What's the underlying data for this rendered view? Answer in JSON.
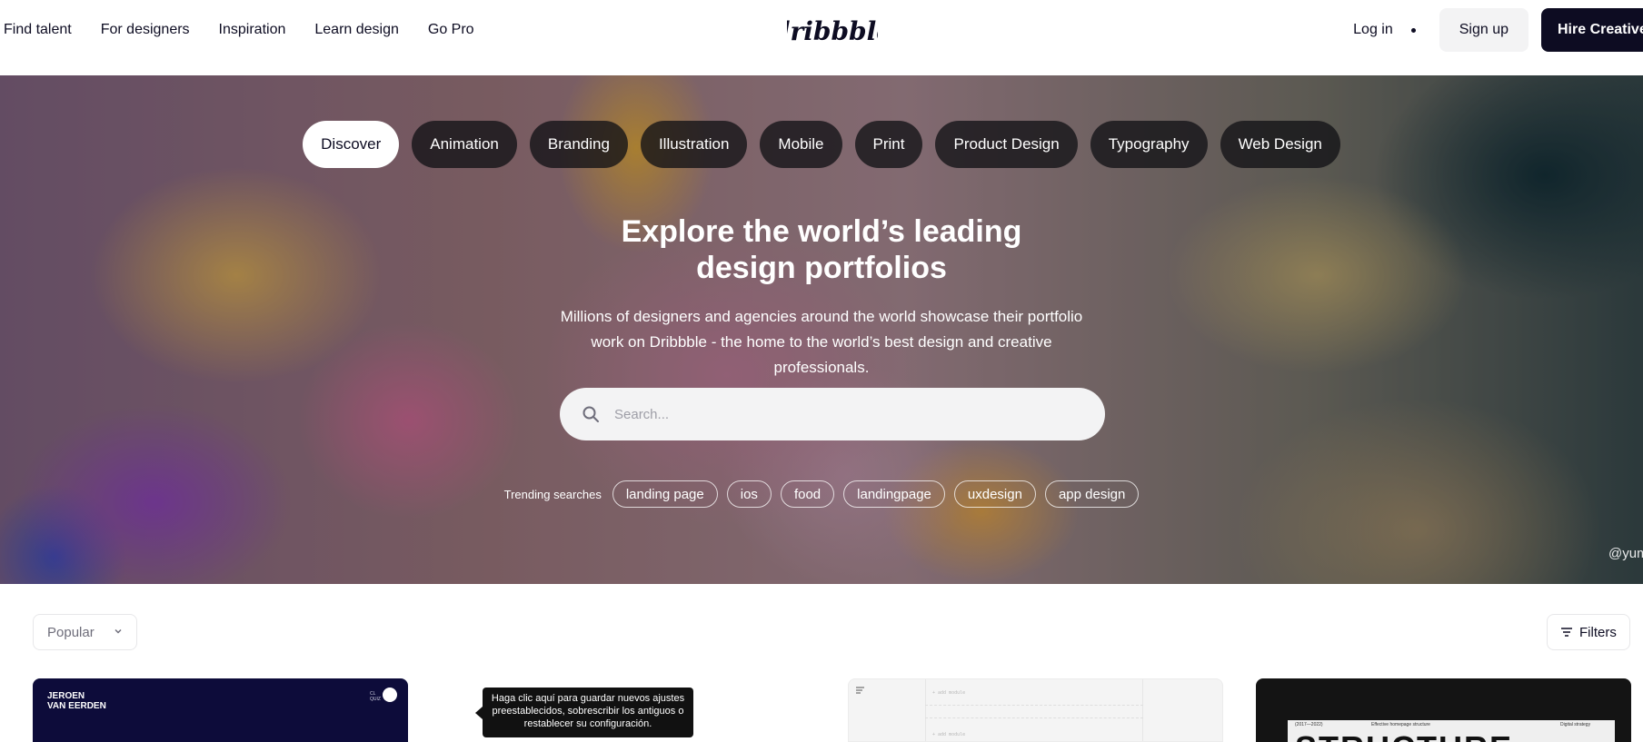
{
  "nav": {
    "links": [
      "Find talent",
      "For designers",
      "Inspiration",
      "Learn design",
      "Go Pro"
    ],
    "logo_text": "dribbble",
    "login_label": "Log in",
    "signup_label": "Sign up",
    "hire_label": "Hire Creatives"
  },
  "hero": {
    "categories": [
      "Discover",
      "Animation",
      "Branding",
      "Illustration",
      "Mobile",
      "Print",
      "Product Design",
      "Typography",
      "Web Design"
    ],
    "active_category": "Discover",
    "title_line1": "Explore the world’s leading",
    "title_line2": "design portfolios",
    "subtitle": "Millions of designers and agencies around the world showcase their portfolio work on Dribbble - the home to the world’s best design and creative professionals.",
    "search_placeholder": "Search...",
    "trending_label": "Trending searches",
    "trending_tags": [
      "landing page",
      "ios",
      "food",
      "landingpage",
      "uxdesign",
      "app design"
    ],
    "credit": "@yumi"
  },
  "filter_bar": {
    "sort_value": "Popular",
    "filters_label": "Filters"
  },
  "shots": {
    "card1_title_line1": "JEROEN",
    "card1_title_line2": "VAN EERDEN",
    "card1_small_line1": "CL",
    "card1_small_line2": "QUIZ",
    "card3_text1": "+ add module",
    "card3_text2": "+ add module",
    "card4_meta_left": "(2017—2022)",
    "card4_meta_center": "Effective homepage structure",
    "card4_meta_right": "Digital strategy",
    "card4_big": "STRUCTURE"
  },
  "tooltip": {
    "text": "Haga clic aquí para guardar nuevos ajustes preestablecidos, sobrescribir los antiguos o restablecer su configuración."
  },
  "colors": {
    "brand_dark": "#0d0c22",
    "pill_bg": "#1c1c20",
    "search_bg": "#f3f3f4"
  },
  "icons": {
    "search": "search-icon",
    "chevron": "chevron-down-icon",
    "filters": "filter-lines-icon"
  }
}
